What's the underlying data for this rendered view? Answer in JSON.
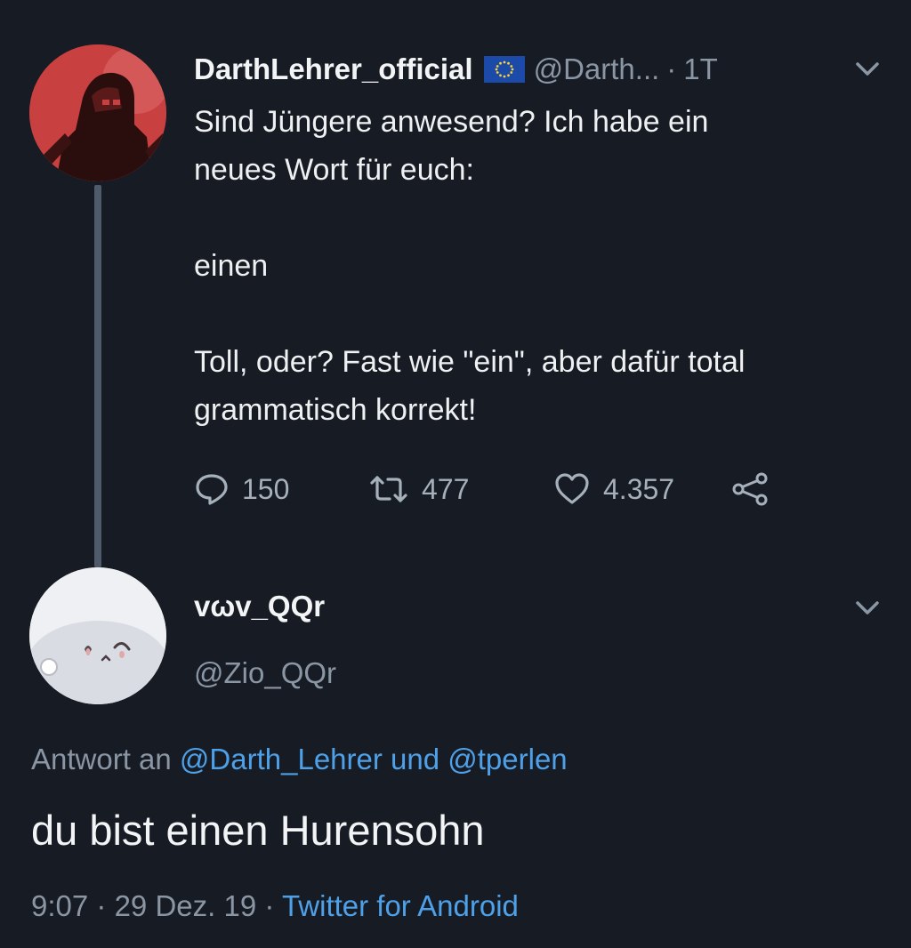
{
  "tweet": {
    "display_name": "DarthLehrer_official",
    "flag_icon": "eu-flag-icon",
    "handle": "@Darth...",
    "separator": "·",
    "time": "1T",
    "text": "Sind Jüngere anwesend? Ich habe ein\nneues Wort für euch:\n\neinen\n\nToll, oder? Fast wie \"ein\", aber dafür total\ngrammatisch korrekt!",
    "replies": "150",
    "retweets": "477",
    "likes": "4.357"
  },
  "reply": {
    "display_name": "vωv_QQr",
    "handle": "@Zio_QQr",
    "replying_prefix": "Antwort an",
    "replying_to": "@Darth_Lehrer und @tperlen",
    "text": "du bist einen Hurensohn",
    "time": "9:07",
    "sep1": "·",
    "date": "29 Dez. 19",
    "sep2": "·",
    "client": "Twitter for Android"
  },
  "colors": {
    "background": "#161b24",
    "link": "#4ea1e8",
    "muted": "#8a96a3",
    "eu_blue": "#1c4aa8",
    "eu_star": "#f5d23a"
  }
}
